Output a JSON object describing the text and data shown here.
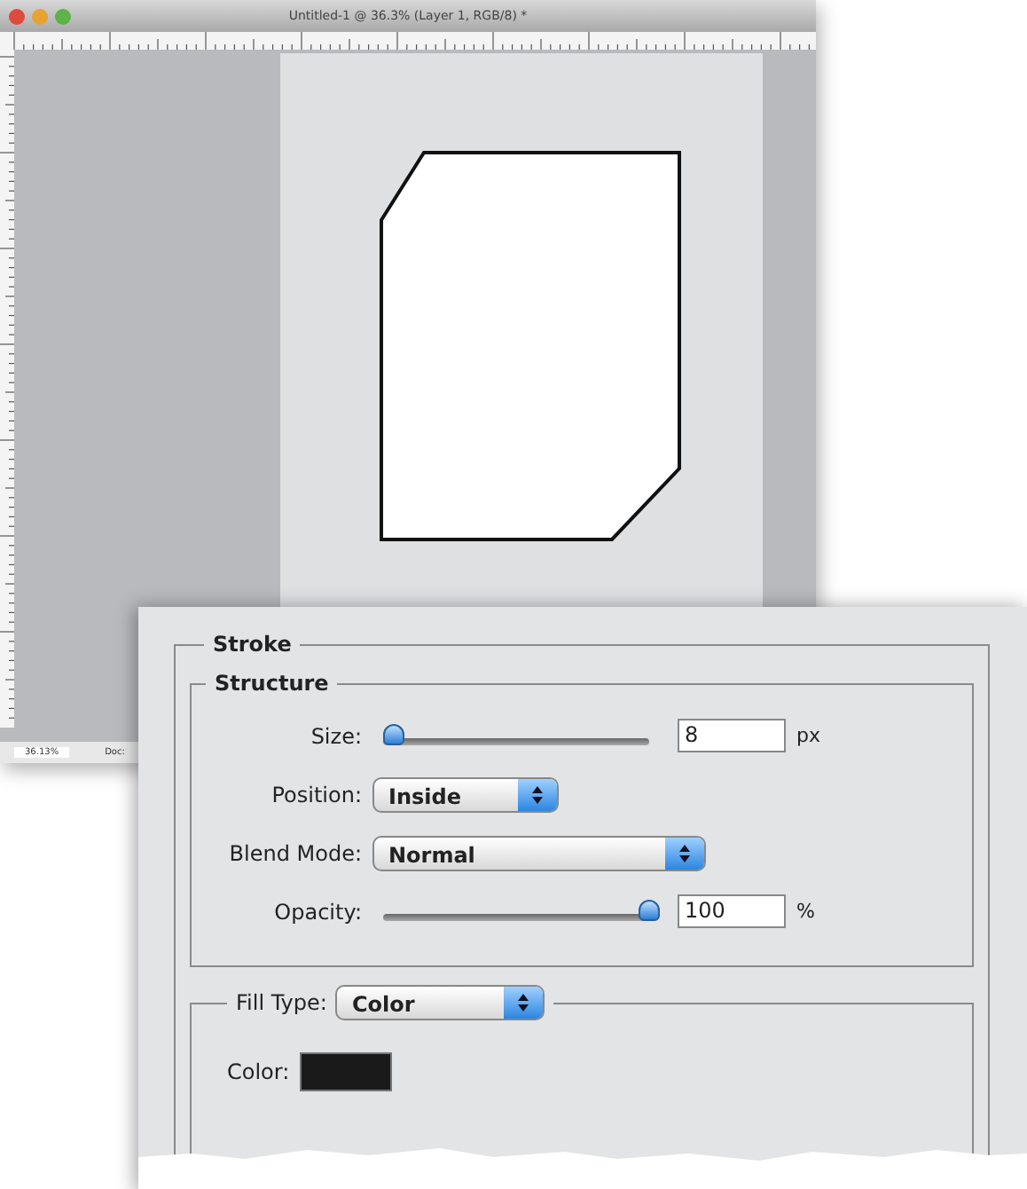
{
  "window": {
    "title": "Untitled-1 @ 36.3% (Layer 1, RGB/8) *"
  },
  "status_bar": {
    "zoom": "36.13%",
    "doc": "Doc:"
  },
  "dialog": {
    "group": "Stroke",
    "structure": {
      "title": "Structure",
      "size": {
        "label": "Size:",
        "level": 0.04,
        "value": "8",
        "unit": "px"
      },
      "position": {
        "label": "Position:",
        "value": "Inside"
      },
      "blend_mode": {
        "label": "Blend Mode:",
        "value": "Normal"
      },
      "opacity": {
        "label": "Opacity:",
        "level": 1,
        "value": "100",
        "unit": "%"
      }
    },
    "fill_type": {
      "label": "Fill Type:",
      "value": "Color",
      "color_label": "Color:",
      "color": "#1a1a1a"
    }
  }
}
